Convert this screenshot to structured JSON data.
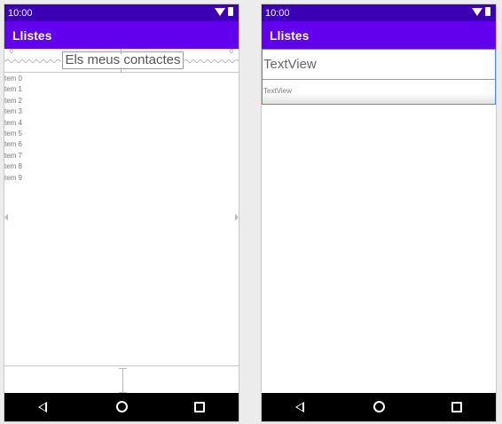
{
  "status_bar": {
    "time": "10:00"
  },
  "app": {
    "title": "Llistes"
  },
  "left": {
    "header_title": "Els meus contactes",
    "corner_left": "0",
    "corner_right": "0",
    "items": [
      "tem 0",
      "tem 1",
      "tem 2",
      "tem 3",
      "tem 4",
      "tem 5",
      "tem 6",
      "tem 7",
      "tem 8",
      "tem 9"
    ]
  },
  "right": {
    "textview_large": "TextView",
    "textview_small": "TextView"
  },
  "icons": {
    "wifi": "wifi-icon",
    "battery": "battery-icon",
    "back": "back-icon",
    "home": "home-icon",
    "recents": "recents-icon"
  },
  "colors": {
    "status_bar": "#3b00b3",
    "app_bar": "#6200ee",
    "nav_bar": "#000000",
    "selection": "#4a90e2"
  }
}
